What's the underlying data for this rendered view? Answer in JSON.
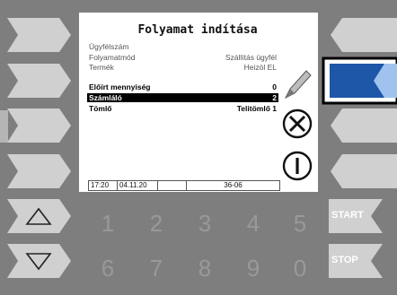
{
  "screen": {
    "title": "Folyamat indítása",
    "rows": [
      {
        "label": "Ügyfélszám",
        "value": ""
      },
      {
        "label": "Folyamatmód",
        "value": "Szállítás ügyfél"
      },
      {
        "label": "Termék",
        "value": "Heizöl EL"
      },
      {
        "label": "Előírt mennyiség",
        "value": "0"
      },
      {
        "label": "Számláló",
        "value": "2"
      },
      {
        "label": "Tömlő",
        "value": "Telitömlő 1"
      }
    ],
    "status": {
      "time": "17:20",
      "date": "04.11.20",
      "blank": "",
      "code": "36-06"
    }
  },
  "keypad": {
    "digits_top": [
      "1",
      "2",
      "3",
      "4",
      "5"
    ],
    "digits_bottom": [
      "6",
      "7",
      "8",
      "9",
      "0"
    ],
    "start_label": "START",
    "stop_label": "STOP"
  },
  "icons": {
    "edit": "pencil-icon",
    "cancel": "cancel-x-icon",
    "info": "info-i-icon",
    "up": "triangle-up-icon",
    "down": "triangle-down-icon"
  },
  "colors": {
    "highlight_button": "#1e56a8",
    "highlight_tip": "#9fc3ee",
    "frame": "#7e7e7e",
    "button": "#cfcfcf"
  }
}
